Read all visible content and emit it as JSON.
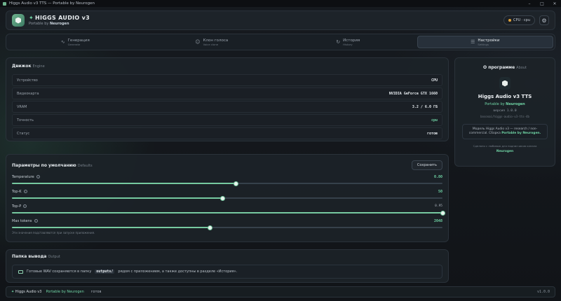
{
  "window": {
    "title": "Higgs Audio v3 TTS — Portable by Neurogen"
  },
  "header": {
    "title": "HIGGS AUDIO v3",
    "subtitle_prefix": "Portable by",
    "subtitle_author": "Neurogen",
    "device_label": "CPU · cpu"
  },
  "tabs": [
    {
      "label": "Генерация",
      "sub": "Generate"
    },
    {
      "label": "Клон голоса",
      "sub": "Voice clone"
    },
    {
      "label": "История",
      "sub": "History"
    },
    {
      "label": "Настройки",
      "sub": "Settings"
    }
  ],
  "engine": {
    "title": "Движок",
    "title_en": "Engine",
    "rows": [
      {
        "key": "Устройство",
        "value": "CPU"
      },
      {
        "key": "Видеокарта",
        "value": "NVIDIA GeForce GTX 1660"
      },
      {
        "key": "VRAM",
        "value": "3.2 / 6.0 ГБ"
      },
      {
        "key": "Точность",
        "value": "cpu"
      },
      {
        "key": "Статус",
        "value": "готов"
      }
    ]
  },
  "about": {
    "title": "О программе",
    "title_en": "About",
    "name": "Higgs Audio v3 TTS",
    "by_prefix": "Portable by",
    "by_author": "Neurogen",
    "version": "версия 1.0.0",
    "repo": "bosonai/higgs-audio-v3-tts-4b",
    "note_text": "Модель Higgs Audio v3 — research / non-commercial. Сборка",
    "note_bold": "Portable by Neurogen.",
    "foot": "Сделано с любовью для подписчиков канала",
    "foot_author": "Neurogen"
  },
  "defaults": {
    "title": "Параметры по умолчанию",
    "title_en": "Defaults",
    "save_label": "Сохранить",
    "params": [
      {
        "name": "Temperature",
        "value": "0.80",
        "fraction": 0.52
      },
      {
        "name": "Top-K",
        "value": "50",
        "fraction": 0.49
      },
      {
        "name": "Top-P",
        "value": "0.95",
        "fraction": 1.0
      },
      {
        "name": "Max tokens",
        "value": "2048",
        "fraction": 0.46
      }
    ],
    "hint": "Эти значения подставляются при запуске приложения."
  },
  "output": {
    "title": "Папка вывода",
    "title_en": "Output",
    "text_before": "Готовые WAV сохраняются в папку",
    "path": "outputs/",
    "text_after": "рядом с приложением, а также доступны в разделе «История»."
  },
  "statusbar": {
    "brand": "Higgs Audio v3",
    "by": "Portable by Neurogen",
    "status": "готов",
    "version": "v1.0.0"
  },
  "icons": {
    "tabs": [
      "wave-icon",
      "user-voice-icon",
      "history-icon",
      "settings-sliders-icon"
    ]
  },
  "colors": {
    "accent": "#6fd3a4",
    "warning_dot": "#e0a23a"
  }
}
